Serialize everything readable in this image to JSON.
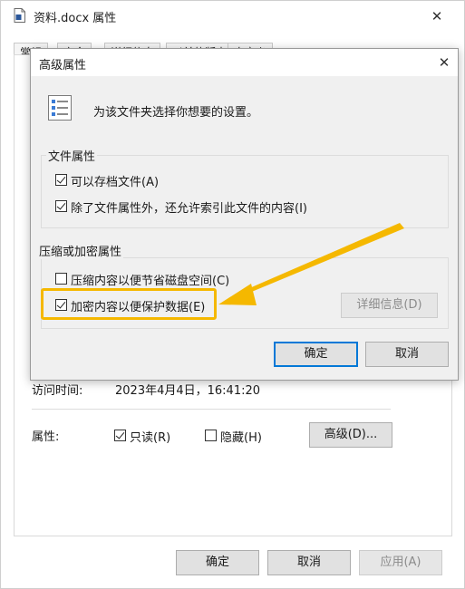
{
  "outer": {
    "title": "资料.docx 属性",
    "close_glyph": "✕",
    "tabs": [
      "常规",
      "安全",
      "详细信息",
      "以前的版本",
      "自定义"
    ],
    "access_time_label": "访问时间:",
    "access_time_value": "2023年4月4日，16:41:20",
    "attributes_label": "属性:",
    "readonly_label": "只读(R)",
    "readonly_checked": true,
    "hidden_label": "隐藏(H)",
    "hidden_checked": false,
    "advanced_button": "高级(D)...",
    "ok_button": "确定",
    "cancel_button": "取消",
    "apply_button": "应用(A)"
  },
  "advanced": {
    "title": "高级属性",
    "close_glyph": "✕",
    "description": "为该文件夹选择你想要的设置。",
    "file_attributes_group": "文件属性",
    "archive_label": "可以存档文件(A)",
    "archive_checked": true,
    "index_label": "除了文件属性外，还允许索引此文件的内容(I)",
    "index_checked": true,
    "compress_encrypt_group": "压缩或加密属性",
    "compress_label": "压缩内容以便节省磁盘空间(C)",
    "compress_checked": false,
    "encrypt_label": "加密内容以便保护数据(E)",
    "encrypt_checked": true,
    "details_button": "详细信息(D)",
    "ok_button": "确定",
    "cancel_button": "取消"
  },
  "annotation": {
    "color": "#f5b800"
  }
}
